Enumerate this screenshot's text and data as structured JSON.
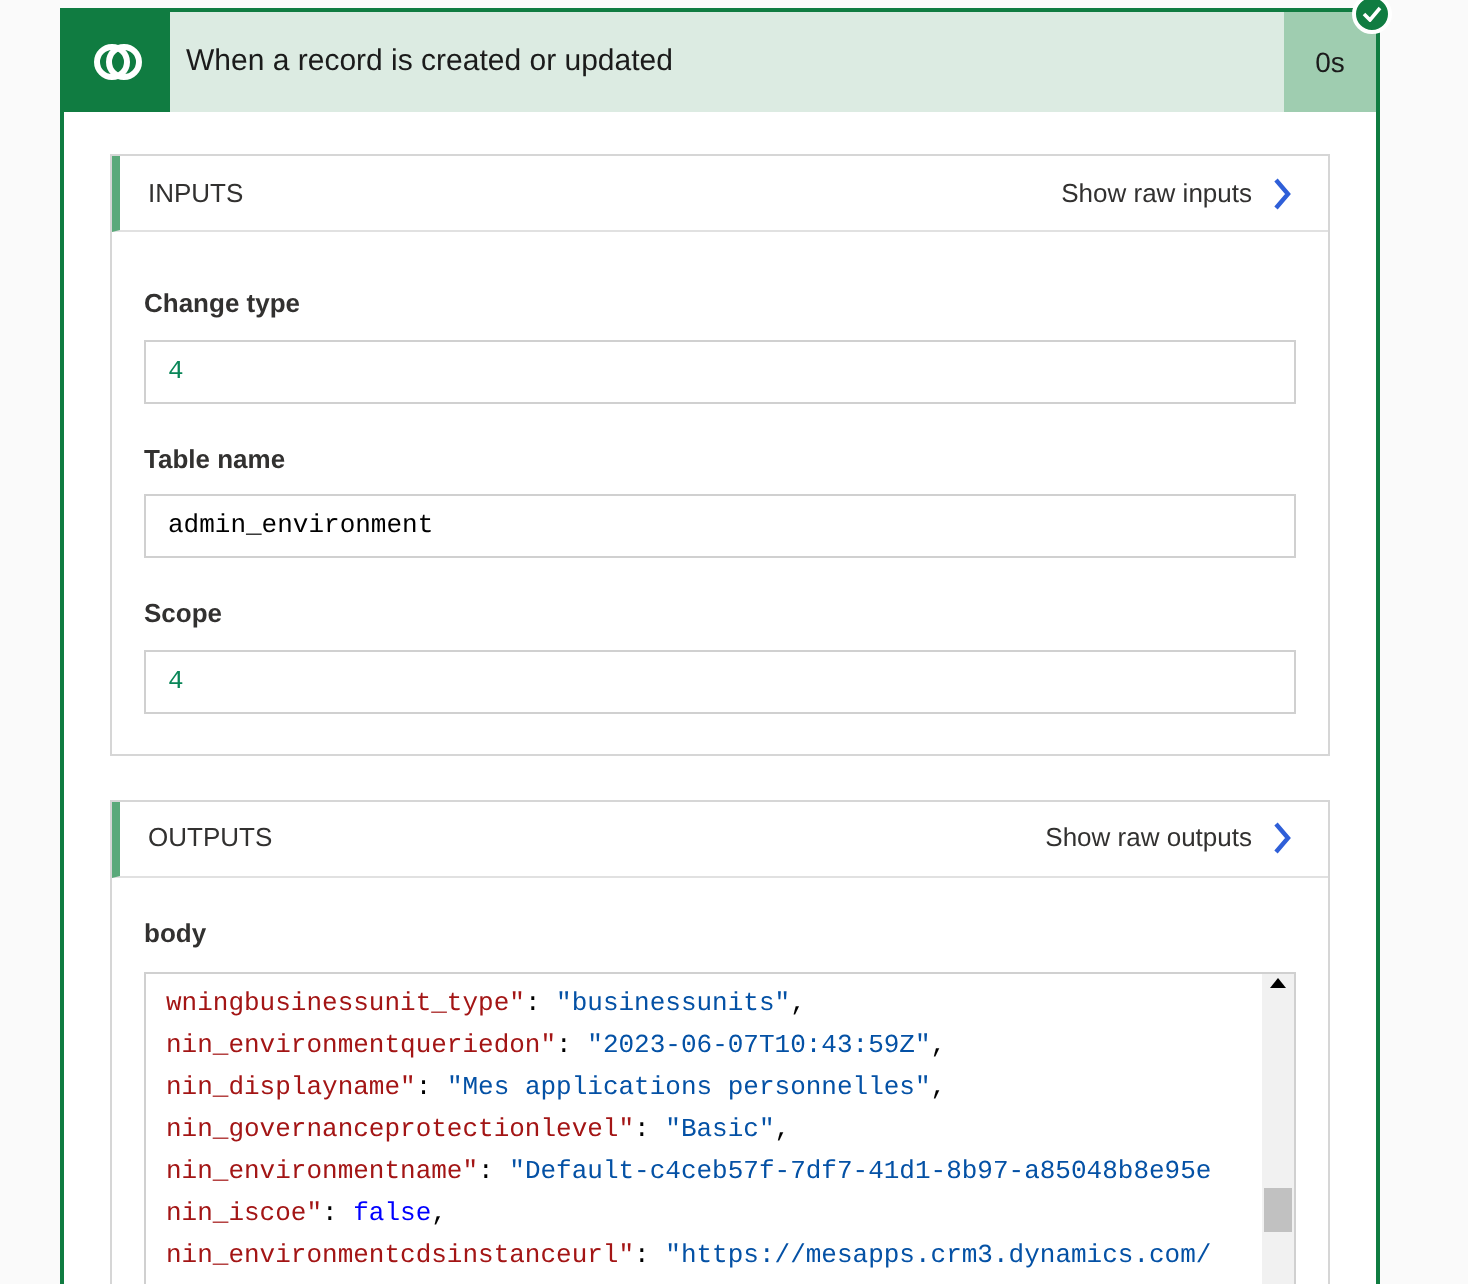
{
  "trigger": {
    "title": "When a record is created or updated",
    "duration": "0s",
    "succeeded": true
  },
  "inputs": {
    "title": "INPUTS",
    "raw_link": "Show raw inputs",
    "fields": [
      {
        "label": "Change type",
        "value": "4",
        "kind": "number"
      },
      {
        "label": "Table name",
        "value": "admin_environment",
        "kind": "text"
      },
      {
        "label": "Scope",
        "value": "4",
        "kind": "number"
      }
    ]
  },
  "outputs": {
    "title": "OUTPUTS",
    "raw_link": "Show raw outputs",
    "body_label": "body",
    "code_lines": [
      [
        {
          "text": "wningbusinessunit_type\"",
          "kind": "key"
        },
        {
          "text": ": ",
          "kind": "punct"
        },
        {
          "text": "\"businessunits\"",
          "kind": "string"
        },
        {
          "text": ",",
          "kind": "punct"
        }
      ],
      [
        {
          "text": "nin_environmentqueriedon\"",
          "kind": "key"
        },
        {
          "text": ": ",
          "kind": "punct"
        },
        {
          "text": "\"2023-06-07T10:43:59Z\"",
          "kind": "string"
        },
        {
          "text": ",",
          "kind": "punct"
        }
      ],
      [
        {
          "text": "nin_displayname\"",
          "kind": "key"
        },
        {
          "text": ": ",
          "kind": "punct"
        },
        {
          "text": "\"Mes applications personnelles\"",
          "kind": "string"
        },
        {
          "text": ",",
          "kind": "punct"
        }
      ],
      [
        {
          "text": "nin_governanceprotectionlevel\"",
          "kind": "key"
        },
        {
          "text": ": ",
          "kind": "punct"
        },
        {
          "text": "\"Basic\"",
          "kind": "string"
        },
        {
          "text": ",",
          "kind": "punct"
        }
      ],
      [
        {
          "text": "nin_environmentname\"",
          "kind": "key"
        },
        {
          "text": ": ",
          "kind": "punct"
        },
        {
          "text": "\"Default-c4ceb57f-7df7-41d1-8b97-a85048b8e95e",
          "kind": "string"
        }
      ],
      [
        {
          "text": "nin_iscoe\"",
          "kind": "key"
        },
        {
          "text": ": ",
          "kind": "punct"
        },
        {
          "text": "false",
          "kind": "literal"
        },
        {
          "text": ",",
          "kind": "punct"
        }
      ],
      [
        {
          "text": "nin_environmentcdsinstanceurl\"",
          "kind": "key"
        },
        {
          "text": ": ",
          "kind": "punct"
        },
        {
          "text": "\"https://mesapps.crm3.dynamics.com/",
          "kind": "string"
        }
      ]
    ]
  }
}
